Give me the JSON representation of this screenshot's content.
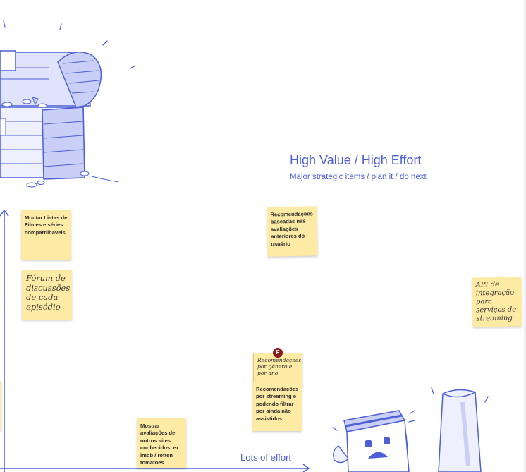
{
  "quadrant": {
    "title": "High Value / High Effort",
    "subtitle": "Major strategic items / plan it / do next"
  },
  "axis": {
    "x_label": "Lots of effort"
  },
  "notes": [
    {
      "text": "Montar Listas de Filmes e séries compartilháveis"
    },
    {
      "text": "Fórum de discussões de cada episódio"
    },
    {
      "text": "Recomendações baseadas nas avaliações anteriores do usuário"
    },
    {
      "text": "API de integração para serviços de streaming"
    },
    {
      "text": "Recomendações por gênero e por ano"
    },
    {
      "text": "Recomendações por streaming e podendo filtrar por ainda não assistidos"
    },
    {
      "text": "Mostrar avaliações de outros sites conhecidos, ex: imdb / rotten tomatoes"
    }
  ],
  "cursor_badge": {
    "label": "F"
  },
  "colors": {
    "accent": "#4d5fd6",
    "sticky": "#fdeaa4",
    "badge": "#8b1c1c"
  },
  "icons": [
    "treasure-chest-illustration",
    "sad-jars-illustration"
  ]
}
